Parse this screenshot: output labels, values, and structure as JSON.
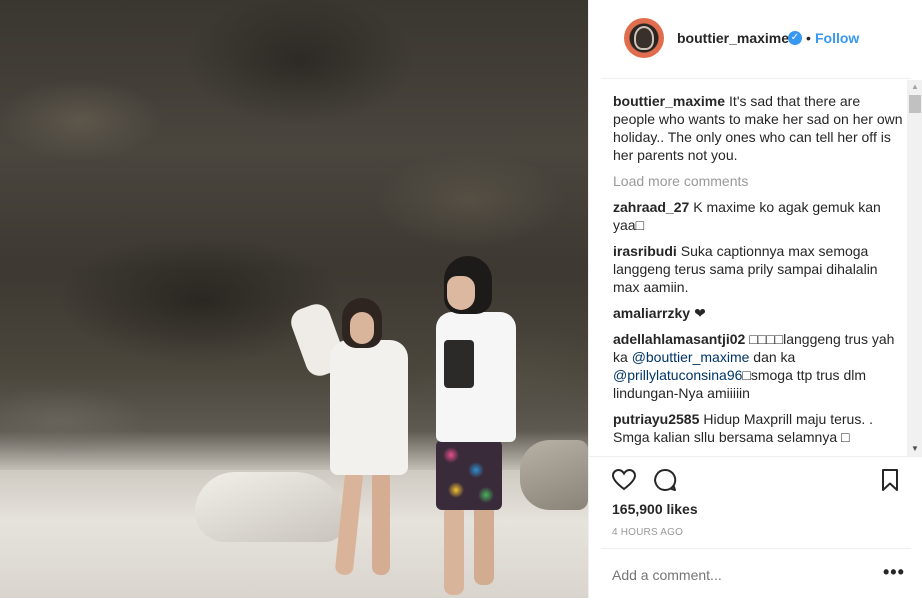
{
  "post": {
    "username": "bouttier_maxime",
    "verified_icon": "verified-badge-icon",
    "separator": "•",
    "follow_label": "Follow"
  },
  "caption": {
    "user": "bouttier_maxime",
    "text": "It's sad that there are people who wants to make her sad on her own holiday.. The only ones who can tell her off is her parents not you."
  },
  "load_more_label": "Load more comments",
  "comments": [
    {
      "user": "zahraad_27",
      "text": "K maxime ko agak gemuk kan yaa□"
    },
    {
      "user": "irasribudi",
      "text": "Suka captionnya max semoga langgeng terus sama prily sampai dihalalin max aamiin."
    },
    {
      "user": "amaliarrzky",
      "text": "❤"
    },
    {
      "user": "adellahlamasantji02",
      "pre": "□□□□langgeng trus yah ka ",
      "mention1": "@bouttier_maxime",
      "mid": " dan ka ",
      "mention2": "@prillylatuconsina96",
      "post": "□smoga ttp trus dlm lindungan-Nya amiiiiin"
    },
    {
      "user": "putriayu2585",
      "text": "Hidup Maxprill maju terus. . Smga kalian sllu bersama selamnya □"
    }
  ],
  "actions": {
    "like_icon": "heart-icon",
    "comment_icon": "comment-bubble-icon",
    "save_icon": "bookmark-icon"
  },
  "likes": "165,900 likes",
  "time_ago": "4 HOURS AGO",
  "add_comment_placeholder": "Add a comment...",
  "more_options": "•••",
  "scroll_up_arrow": "▲",
  "scroll_down_arrow": "▼"
}
